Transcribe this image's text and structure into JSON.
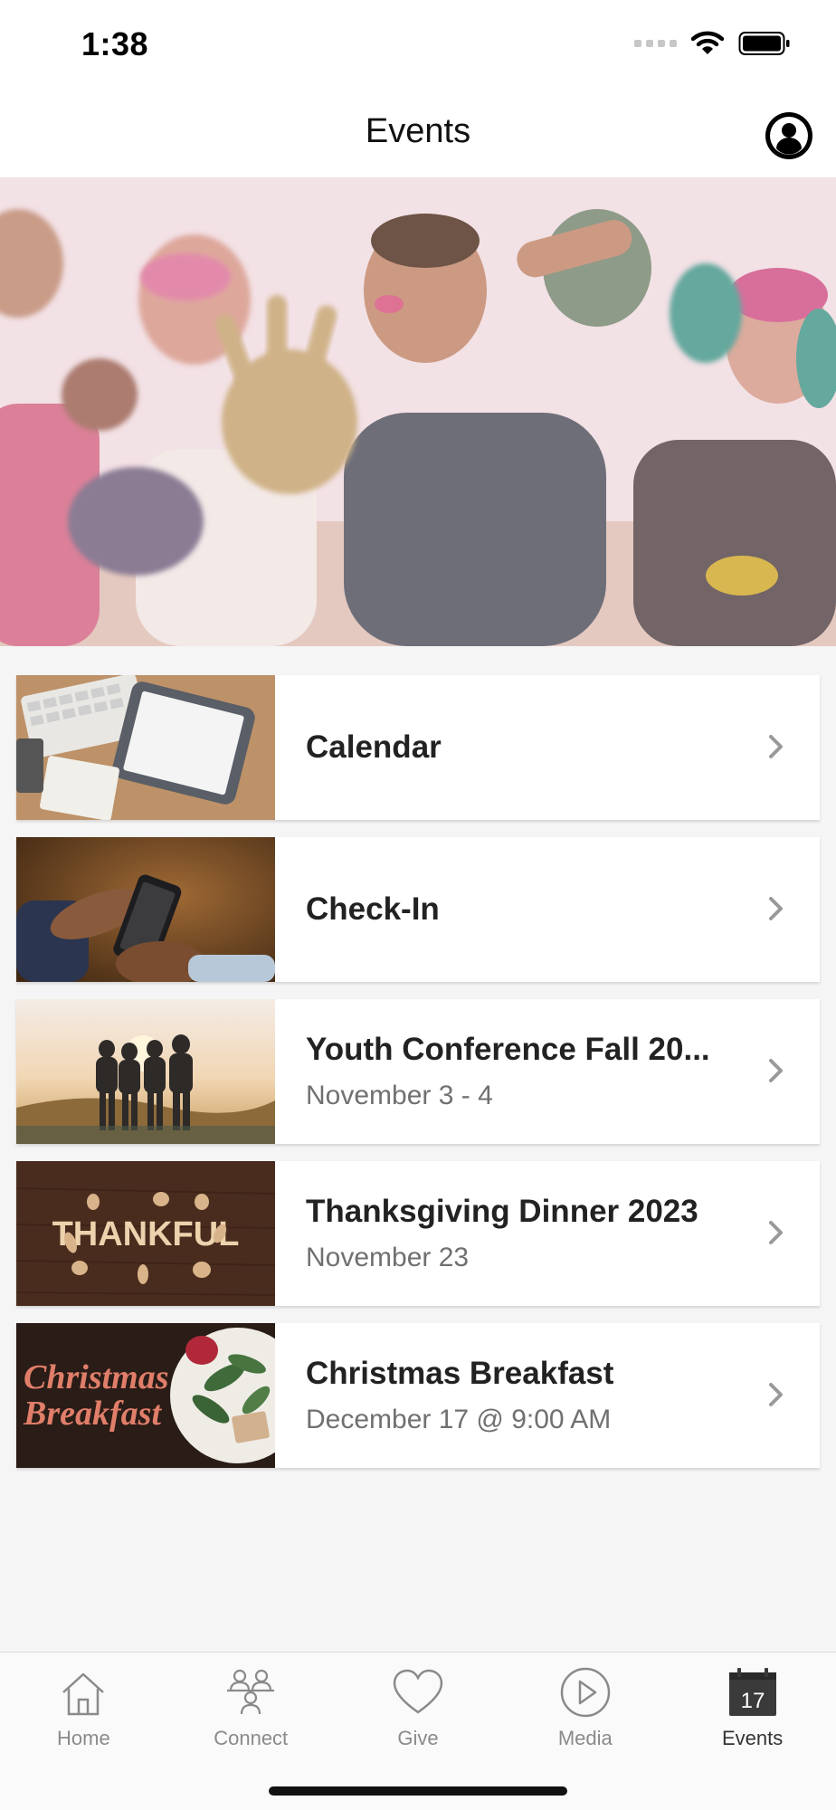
{
  "status_bar": {
    "time": "1:38"
  },
  "nav": {
    "title": "Events"
  },
  "events": [
    {
      "title": "Calendar",
      "subtitle": ""
    },
    {
      "title": "Check-In",
      "subtitle": ""
    },
    {
      "title": "Youth Conference Fall 20...",
      "subtitle": "November 3 - 4"
    },
    {
      "title": "Thanksgiving Dinner 2023",
      "subtitle": "November 23"
    },
    {
      "title": "Christmas Breakfast",
      "subtitle": "December 17 @ 9:00 AM"
    }
  ],
  "thumb_text": {
    "thankful": "THANKFUL",
    "christmas_line1": "Christmas",
    "christmas_line2": "Breakfast"
  },
  "tabs": [
    {
      "label": "Home",
      "icon": "home-icon"
    },
    {
      "label": "Connect",
      "icon": "connect-icon"
    },
    {
      "label": "Give",
      "icon": "heart-icon"
    },
    {
      "label": "Media",
      "icon": "play-icon"
    },
    {
      "label": "Events",
      "icon": "calendar-icon",
      "active": true,
      "calendar_day": "17"
    }
  ],
  "colors": {
    "accent": "#333333",
    "inactive": "#8a8a8a",
    "background": "#f5f5f5"
  }
}
